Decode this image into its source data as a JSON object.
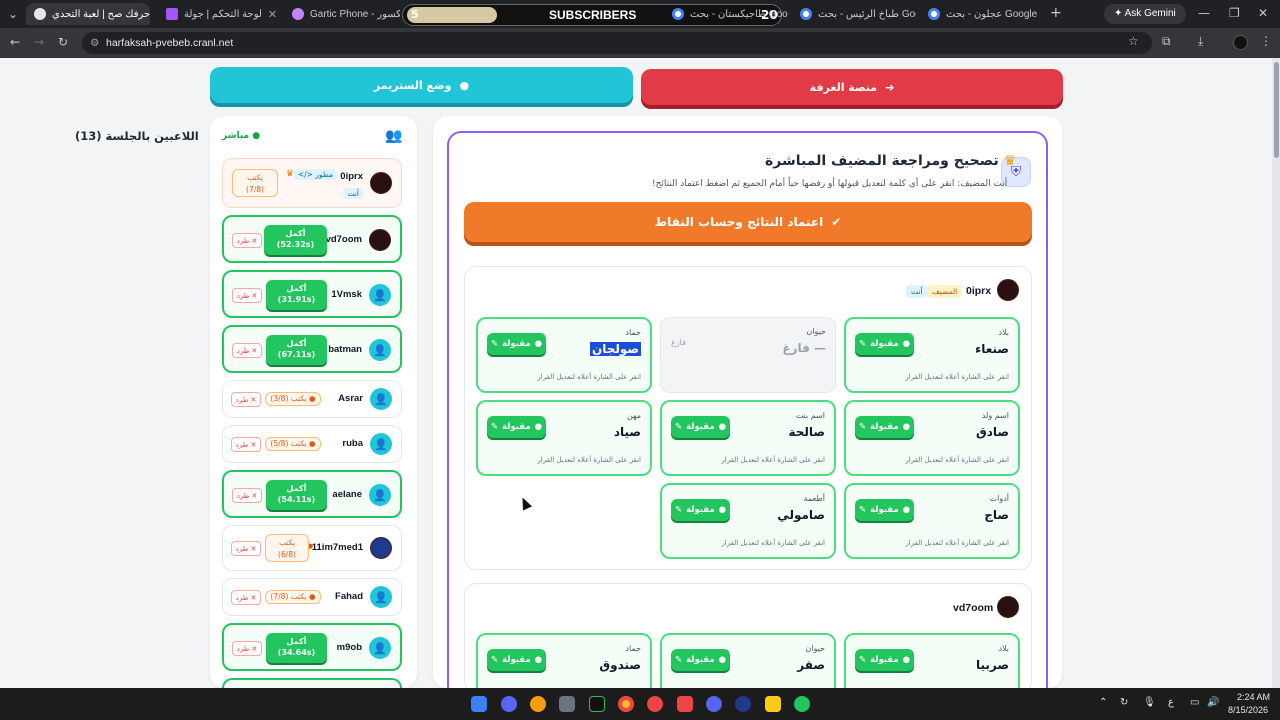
{
  "browser": {
    "tabs": [
      {
        "label": "حرفك صح | لعبة التحدي",
        "active": true
      },
      {
        "label": ""
      },
      {
        "label": "لوحة التحكم | جولة"
      },
      {
        "label": "Gartic Phone - المكسور"
      },
      {
        "label": "SUBSCRIBERS",
        "overlay_left": "5",
        "overlay_right": "20"
      },
      {
        "label": "طاجيكستان - بحث Google"
      },
      {
        "label": "طباخ الرئيس - بحث Google"
      },
      {
        "label": "عجلون - بحث Google"
      }
    ],
    "new_tab": "+",
    "ask_gemini": "Ask Gemini",
    "url": "harfaksah-pvebeb.cranl.net"
  },
  "top_buttons": {
    "streamer_mode": "وضع الستريمر",
    "back": "منصة الغرفة"
  },
  "players_panel": {
    "title": "اللاعبين بالجلسة (13)",
    "live": "مباشر",
    "kick_label": "طرد",
    "players": [
      {
        "name": "0iprx",
        "dev": "مطور",
        "you": "أنت",
        "status": "typing",
        "status_text": "يكتب",
        "progress": "(7/8)",
        "me": true
      },
      {
        "name": "vd7oom",
        "status": "done",
        "status_text": "أكمل",
        "time": "(52.32s)"
      },
      {
        "name": "1Vmsk",
        "status": "done",
        "status_text": "أكمل",
        "time": "(31.91s)"
      },
      {
        "name": "batman",
        "status": "done",
        "status_text": "أكمل",
        "time": "(67.11s)"
      },
      {
        "name": "Asrar",
        "status": "typing",
        "status_text": "يكتب",
        "progress": "(3/8)"
      },
      {
        "name": "ruba",
        "status": "typing",
        "status_text": "يكتب",
        "progress": "(5/8)"
      },
      {
        "name": "aelane",
        "status": "done",
        "status_text": "أكمل",
        "time": "(54.11s)"
      },
      {
        "name": "11im7med1",
        "status": "typing",
        "status_text": "يكتب",
        "progress": "(6/8)"
      },
      {
        "name": "Fahad",
        "status": "typing",
        "status_text": "يكتب",
        "progress": "(7/8)"
      },
      {
        "name": "m9ob",
        "status": "done",
        "status_text": "أكمل",
        "time": "(34.64s)"
      }
    ]
  },
  "main": {
    "title": "تصحيح ومراجعة المضيف المباشرة",
    "subtitle": "أنت المضيف: انقر على أي كلمة لتعديل قبولها أو رفضها حياً أمام الجميع ثم اضغط اعتماد النتائج!",
    "approve_button": "اعتماد النتائج وحساب النقاط",
    "accepted_label": "مقبولة",
    "hint": "انقر على الشارة أعلاه لتعديل القرار",
    "empty_tag": "فارغ",
    "host_badge": "المضيف",
    "you_badge": "أنت",
    "cards": [
      {
        "player": "0iprx",
        "answers": [
          {
            "category": "بلاد",
            "word": "صنعاء"
          },
          {
            "category": "حيوان",
            "word": "— فارغ",
            "empty": true
          },
          {
            "category": "جماد",
            "word": "صولجان",
            "selected": true
          },
          {
            "category": "اسم ولد",
            "word": "صادق"
          },
          {
            "category": "اسم بنت",
            "word": "صالحة"
          },
          {
            "category": "مهن",
            "word": "صياد"
          },
          {
            "category": "أدوات",
            "word": "صاج"
          },
          {
            "category": "أطعمة",
            "word": "صامولي"
          }
        ]
      },
      {
        "player": "vd7oom",
        "answers": [
          {
            "category": "بلاد",
            "word": "صربيا"
          },
          {
            "category": "حيوان",
            "word": "صقر"
          },
          {
            "category": "جماد",
            "word": "صندوق"
          }
        ]
      }
    ]
  },
  "taskbar": {
    "lang": "ع",
    "time": "2:24 AM",
    "date": "8/15/2026"
  }
}
